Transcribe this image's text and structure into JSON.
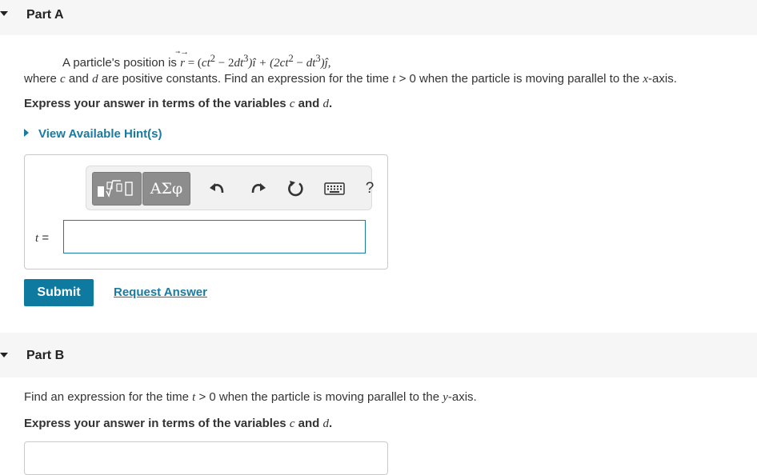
{
  "partA": {
    "title": "Part A",
    "question": {
      "intro": "A particle's position is ",
      "vec": "r",
      "eq": " = (",
      "t1": "ct",
      "sup1": "2",
      "minus1": " − 2",
      "t2": "dt",
      "sup2": "3",
      "ihat": ")î + (2",
      "t3": "ct",
      "sup3": "2",
      "minus2": " − ",
      "t4": "dt",
      "sup4": "3",
      "jhat": ")ĵ,",
      "where": "where ",
      "c": "c",
      "and": " and ",
      "d": "d",
      "rest1": " are positive constants. Find an expression for the time ",
      "t": "t",
      "rest2": " > 0 when the particle is moving parallel to the ",
      "axis": "x",
      "rest3": "-axis."
    },
    "instruction": {
      "lead": "Express your answer in terms of the variables ",
      "c": "c",
      "and": " and ",
      "d": "d",
      "end": "."
    },
    "hint_label": "View Available Hint(s)",
    "toolbar": {
      "symbols_label": "ΑΣφ",
      "help_label": "?"
    },
    "answer_var": "t",
    "answer_eq": " =",
    "answer_value": "",
    "submit_label": "Submit",
    "request_label": "Request Answer"
  },
  "partB": {
    "title": "Part B",
    "question": {
      "lead": "Find an expression for the time ",
      "t": "t",
      "mid": " > 0 when the particle is moving parallel to the ",
      "axis": "y",
      "end": "-axis."
    },
    "instruction": {
      "lead": "Express your answer in terms of the variables ",
      "c": "c",
      "and": " and ",
      "d": "d",
      "end": "."
    }
  },
  "colors": {
    "accent": "#1a7aa0",
    "submit_bg": "#0e7aa0",
    "header_bg": "#f6f6f6",
    "toolbar_btn": "#8d8d8d"
  },
  "icons": [
    "templates-icon",
    "undo-icon",
    "redo-icon",
    "reset-icon",
    "keyboard-icon",
    "help-icon"
  ]
}
